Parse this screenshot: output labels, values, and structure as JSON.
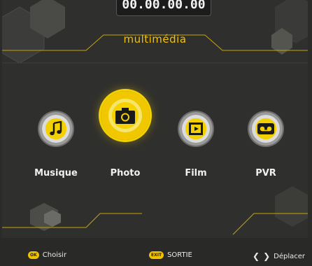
{
  "clock": "00.00.00.00",
  "title": "multimédia",
  "menu": [
    {
      "label": "Musique",
      "icon": "music-note-icon",
      "selected": false
    },
    {
      "label": "Photo",
      "icon": "camera-icon",
      "selected": true
    },
    {
      "label": "Film",
      "icon": "film-icon",
      "selected": false
    },
    {
      "label": "PVR",
      "icon": "tape-recorder-icon",
      "selected": false
    }
  ],
  "footer": {
    "ok_key": "OK",
    "ok_label": "Choisir",
    "exit_key": "EXIT",
    "exit_label": "SORTIE",
    "left_arrow": "❮",
    "right_arrow": "❯",
    "move_label": "Déplacer"
  },
  "colors": {
    "accent": "#f2c200",
    "background": "#2f2f2d"
  }
}
